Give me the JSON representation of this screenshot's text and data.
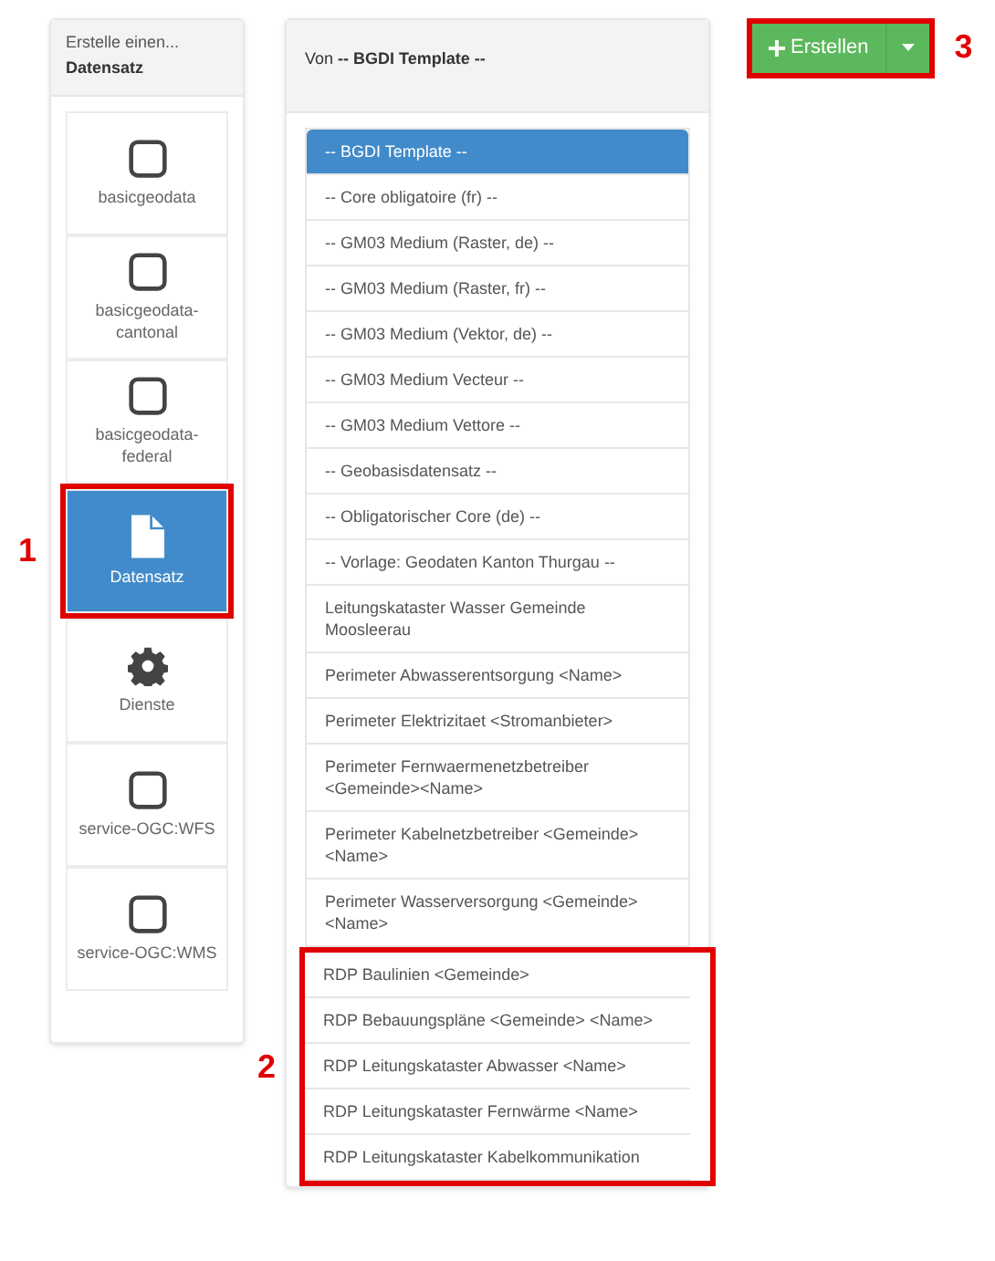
{
  "sidebar": {
    "heading": "Erstelle einen...",
    "subheading": "Datensatz",
    "items": [
      {
        "label": "basicgeodata",
        "kind": "square",
        "selected": false
      },
      {
        "label": "basicgeodata-cantonal",
        "kind": "square",
        "selected": false
      },
      {
        "label": "basicgeodata-federal",
        "kind": "square",
        "selected": false
      },
      {
        "label": "Datensatz",
        "kind": "file",
        "selected": true,
        "callout": "1"
      },
      {
        "label": "Dienste",
        "kind": "gear",
        "selected": false
      },
      {
        "label": "service-OGC:WFS",
        "kind": "square",
        "selected": false
      },
      {
        "label": "service-OGC:WMS",
        "kind": "square",
        "selected": false
      }
    ]
  },
  "templates": {
    "heading": "Von **-- BGDI Template --**",
    "items": [
      {
        "label": "-- BGDI Template --",
        "selected": true
      },
      {
        "label": "-- Core obligatoire (fr) --",
        "selected": false
      },
      {
        "label": "-- GM03 Medium (Raster, de) --",
        "selected": false
      },
      {
        "label": "-- GM03 Medium (Raster, fr) --",
        "selected": false
      },
      {
        "label": "-- GM03 Medium (Vektor, de) --",
        "selected": false
      },
      {
        "label": "-- GM03 Medium Vecteur --",
        "selected": false
      },
      {
        "label": "-- GM03 Medium Vettore --",
        "selected": false
      },
      {
        "label": "-- Geobasisdatensatz --",
        "selected": false
      },
      {
        "label": "-- Obligatorischer Core (de) --",
        "selected": false
      },
      {
        "label": "-- Vorlage: Geodaten Kanton Thurgau --",
        "selected": false
      },
      {
        "label": "Leitungskataster Wasser Gemeinde Moosleerau",
        "selected": false
      },
      {
        "label": "Perimeter Abwasserentsorgung <Name>",
        "selected": false
      },
      {
        "label": "Perimeter Elektrizitaet <Stromanbieter>",
        "selected": false
      },
      {
        "label": "Perimeter Fernwaermenetzbetreiber <Gemeinde><Name>",
        "selected": false
      },
      {
        "label": "Perimeter Kabelnetzbetreiber <Gemeinde><Name>",
        "selected": false
      },
      {
        "label": "Perimeter Wasserversorgung <Gemeinde><Name>",
        "selected": false
      }
    ],
    "highlighted": {
      "callout": "2",
      "items": [
        {
          "label": "RDP Baulinien <Gemeinde>"
        },
        {
          "label": "RDP Bebauungspläne <Gemeinde> <Name>"
        },
        {
          "label": "RDP Leitungskataster Abwasser <Name>"
        },
        {
          "label": "RDP Leitungskataster Fernwärme <Name>"
        },
        {
          "label": "RDP Leitungskataster Kabelkommunikation"
        }
      ]
    }
  },
  "create_button": {
    "label": "Erstellen",
    "callout": "3"
  }
}
